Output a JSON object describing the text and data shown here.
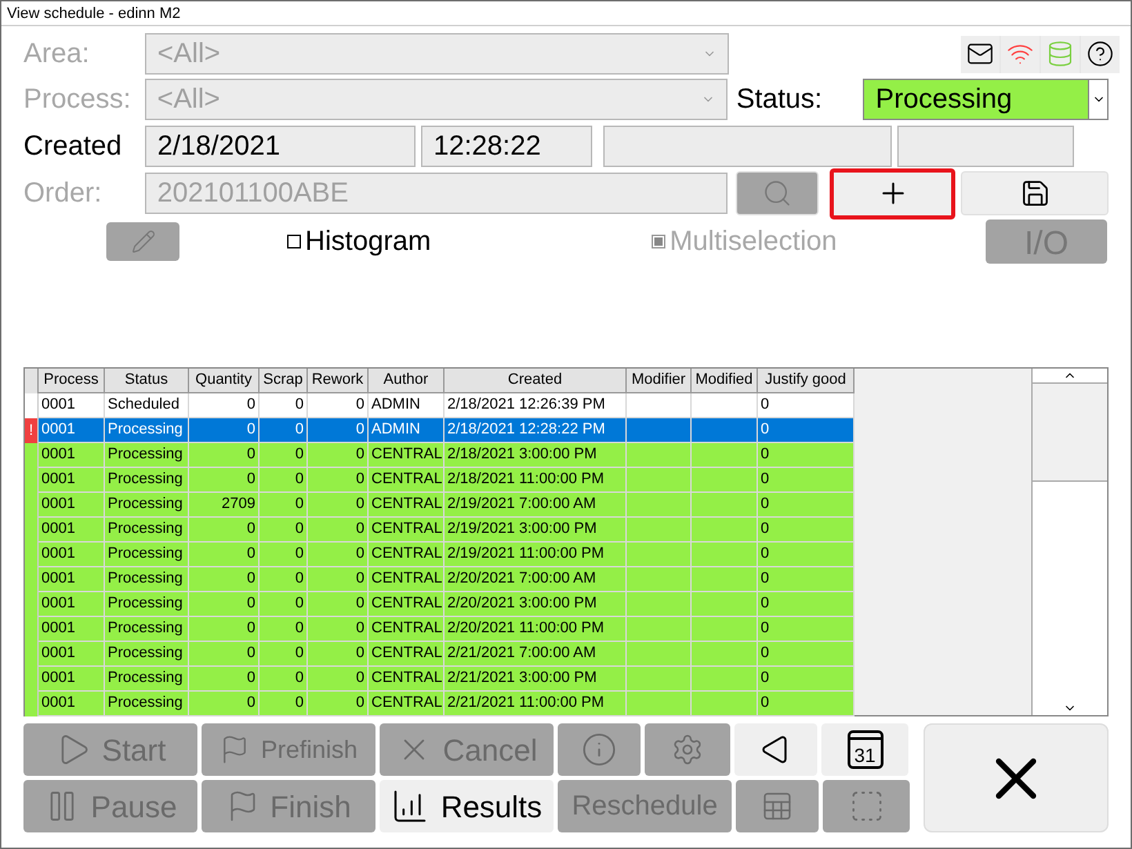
{
  "window": {
    "title": "View schedule - edinn M2"
  },
  "filters": [
    {
      "label": "Area:",
      "value": "<All>",
      "disabled": true
    },
    {
      "label": "Process:",
      "value": "<All>",
      "disabled": true
    }
  ],
  "status": {
    "label": "Status:",
    "value": "Processing"
  },
  "created": {
    "label": "Created",
    "date": "2/18/2021",
    "time": "12:28:22"
  },
  "order": {
    "label": "Order:",
    "value": "202101100ABE",
    "disabled": true
  },
  "order_buttons": [
    {
      "disabled": true,
      "highlighted": false
    },
    {
      "disabled": false,
      "highlighted": true
    },
    {
      "disabled": false,
      "highlighted": false
    }
  ],
  "options": [
    {
      "label": "Histogram",
      "checked": false,
      "disabled": false
    },
    {
      "label": "Multiselection",
      "checked": true,
      "disabled": true
    }
  ],
  "io_button": {
    "label": "I/O",
    "disabled": true
  },
  "table": {
    "columns": [
      "Process",
      "Status",
      "Quantity",
      "Scrap",
      "Rework",
      "Author",
      "Created",
      "Modifier",
      "Modified",
      "Justify good"
    ],
    "rows": [
      {
        "selected": false,
        "color": "#ffffff",
        "cells": [
          "0001",
          "Scheduled",
          "0",
          "0",
          "0",
          "ADMIN",
          "2/18/2021 12:26:39 PM",
          "",
          "",
          "0"
        ]
      },
      {
        "selected": true,
        "color": "#0078d7",
        "marker": "!",
        "cells": [
          "0001",
          "Processing",
          "0",
          "0",
          "0",
          "ADMIN",
          "2/18/2021 12:28:22 PM",
          "",
          "",
          "0"
        ]
      },
      {
        "selected": false,
        "color": "#94ef47",
        "cells": [
          "0001",
          "Processing",
          "0",
          "0",
          "0",
          "CENTRAL",
          "2/18/2021 3:00:00 PM",
          "",
          "",
          "0"
        ]
      },
      {
        "selected": false,
        "color": "#94ef47",
        "cells": [
          "0001",
          "Processing",
          "0",
          "0",
          "0",
          "CENTRAL",
          "2/18/2021 11:00:00 PM",
          "",
          "",
          "0"
        ]
      },
      {
        "selected": false,
        "color": "#94ef47",
        "cells": [
          "0001",
          "Processing",
          "2709",
          "0",
          "0",
          "CENTRAL",
          "2/19/2021 7:00:00 AM",
          "",
          "",
          "0"
        ]
      },
      {
        "selected": false,
        "color": "#94ef47",
        "cells": [
          "0001",
          "Processing",
          "0",
          "0",
          "0",
          "CENTRAL",
          "2/19/2021 3:00:00 PM",
          "",
          "",
          "0"
        ]
      },
      {
        "selected": false,
        "color": "#94ef47",
        "cells": [
          "0001",
          "Processing",
          "0",
          "0",
          "0",
          "CENTRAL",
          "2/19/2021 11:00:00 PM",
          "",
          "",
          "0"
        ]
      },
      {
        "selected": false,
        "color": "#94ef47",
        "cells": [
          "0001",
          "Processing",
          "0",
          "0",
          "0",
          "CENTRAL",
          "2/20/2021 7:00:00 AM",
          "",
          "",
          "0"
        ]
      },
      {
        "selected": false,
        "color": "#94ef47",
        "cells": [
          "0001",
          "Processing",
          "0",
          "0",
          "0",
          "CENTRAL",
          "2/20/2021 3:00:00 PM",
          "",
          "",
          "0"
        ]
      },
      {
        "selected": false,
        "color": "#94ef47",
        "cells": [
          "0001",
          "Processing",
          "0",
          "0",
          "0",
          "CENTRAL",
          "2/20/2021 11:00:00 PM",
          "",
          "",
          "0"
        ]
      },
      {
        "selected": false,
        "color": "#94ef47",
        "cells": [
          "0001",
          "Processing",
          "0",
          "0",
          "0",
          "CENTRAL",
          "2/21/2021 7:00:00 AM",
          "",
          "",
          "0"
        ]
      },
      {
        "selected": false,
        "color": "#94ef47",
        "cells": [
          "0001",
          "Processing",
          "0",
          "0",
          "0",
          "CENTRAL",
          "2/21/2021 3:00:00 PM",
          "",
          "",
          "0"
        ]
      },
      {
        "selected": false,
        "color": "#94ef47",
        "cells": [
          "0001",
          "Processing",
          "0",
          "0",
          "0",
          "CENTRAL",
          "2/21/2021 11:00:00 PM",
          "",
          "",
          "0"
        ]
      }
    ]
  },
  "actions": [
    {
      "kind": "start",
      "label": "Start",
      "disabled": true
    },
    {
      "kind": "prefinish",
      "label": "Prefinish",
      "disabled": true
    },
    {
      "kind": "cancel",
      "label": "Cancel",
      "disabled": true
    },
    {
      "kind": "info",
      "disabled": true
    },
    {
      "kind": "settings",
      "disabled": true
    },
    {
      "kind": "back",
      "disabled": false
    },
    {
      "kind": "calendar",
      "badge": "31",
      "disabled": false
    },
    {
      "kind": "pause",
      "label": "Pause",
      "disabled": true
    },
    {
      "kind": "finish",
      "label": "Finish",
      "disabled": true
    },
    {
      "kind": "results",
      "label": "Results",
      "disabled": false
    },
    {
      "kind": "reschedule",
      "label": "Reschedule",
      "disabled": true
    },
    {
      "kind": "table",
      "disabled": true
    },
    {
      "kind": "resize",
      "disabled": true
    }
  ]
}
